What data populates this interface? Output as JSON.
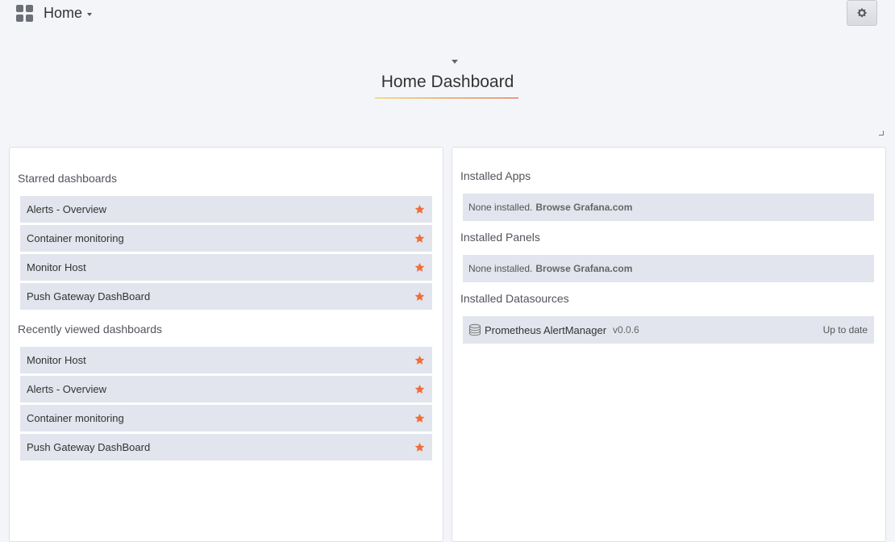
{
  "topbar": {
    "home_label": "Home"
  },
  "dashboard": {
    "title": "Home Dashboard"
  },
  "starred": {
    "heading": "Starred dashboards",
    "items": [
      {
        "label": "Alerts - Overview"
      },
      {
        "label": "Container monitoring"
      },
      {
        "label": "Monitor Host"
      },
      {
        "label": "Push Gateway DashBoard"
      }
    ]
  },
  "recent": {
    "heading": "Recently viewed dashboards",
    "items": [
      {
        "label": "Monitor Host"
      },
      {
        "label": "Alerts - Overview"
      },
      {
        "label": "Container monitoring"
      },
      {
        "label": "Push Gateway DashBoard"
      }
    ]
  },
  "plugins": {
    "apps": {
      "heading": "Installed Apps",
      "none_text": "None installed.",
      "link_text": "Browse Grafana.com"
    },
    "panels": {
      "heading": "Installed Panels",
      "none_text": "None installed.",
      "link_text": "Browse Grafana.com"
    },
    "datasources": {
      "heading": "Installed Datasources",
      "items": [
        {
          "name": "Prometheus AlertManager",
          "version": "v0.0.6",
          "status": "Up to date"
        }
      ]
    }
  },
  "colors": {
    "star": "#f26d3a",
    "accent_start": "#f5c42b",
    "accent_end": "#e34b1c"
  },
  "icons": {
    "app_menu": "grid-icon",
    "settings": "gear-icon",
    "star": "star-icon",
    "datasource": "database-icon"
  }
}
